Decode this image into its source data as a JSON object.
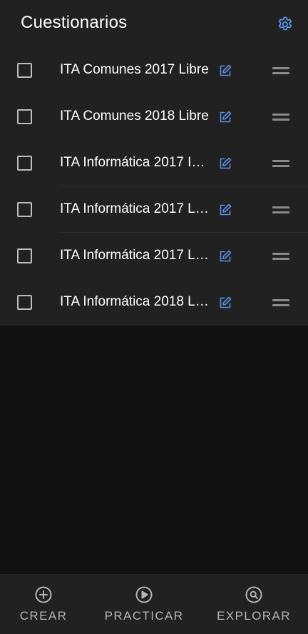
{
  "header": {
    "title": "Cuestionarios",
    "settings_icon": "gear-icon"
  },
  "accent_color": "#5b8fe6",
  "quizzes": [
    {
      "title": "ITA Comunes 2017 Libre",
      "checked": false
    },
    {
      "title": "ITA Comunes 2018 Libre",
      "checked": false
    },
    {
      "title": "ITA Informática 2017 I…",
      "checked": false
    },
    {
      "title": "ITA Informática 2017 L…",
      "checked": false
    },
    {
      "title": "ITA Informática 2017 L…",
      "checked": false
    },
    {
      "title": "ITA Informática 2018 L…",
      "checked": false
    }
  ],
  "bottom_nav": {
    "items": [
      {
        "label": "CREAR",
        "icon": "add-circle-icon"
      },
      {
        "label": "PRACTICAR",
        "icon": "play-circle-icon"
      },
      {
        "label": "EXPLORAR",
        "icon": "search-circle-icon"
      }
    ]
  }
}
